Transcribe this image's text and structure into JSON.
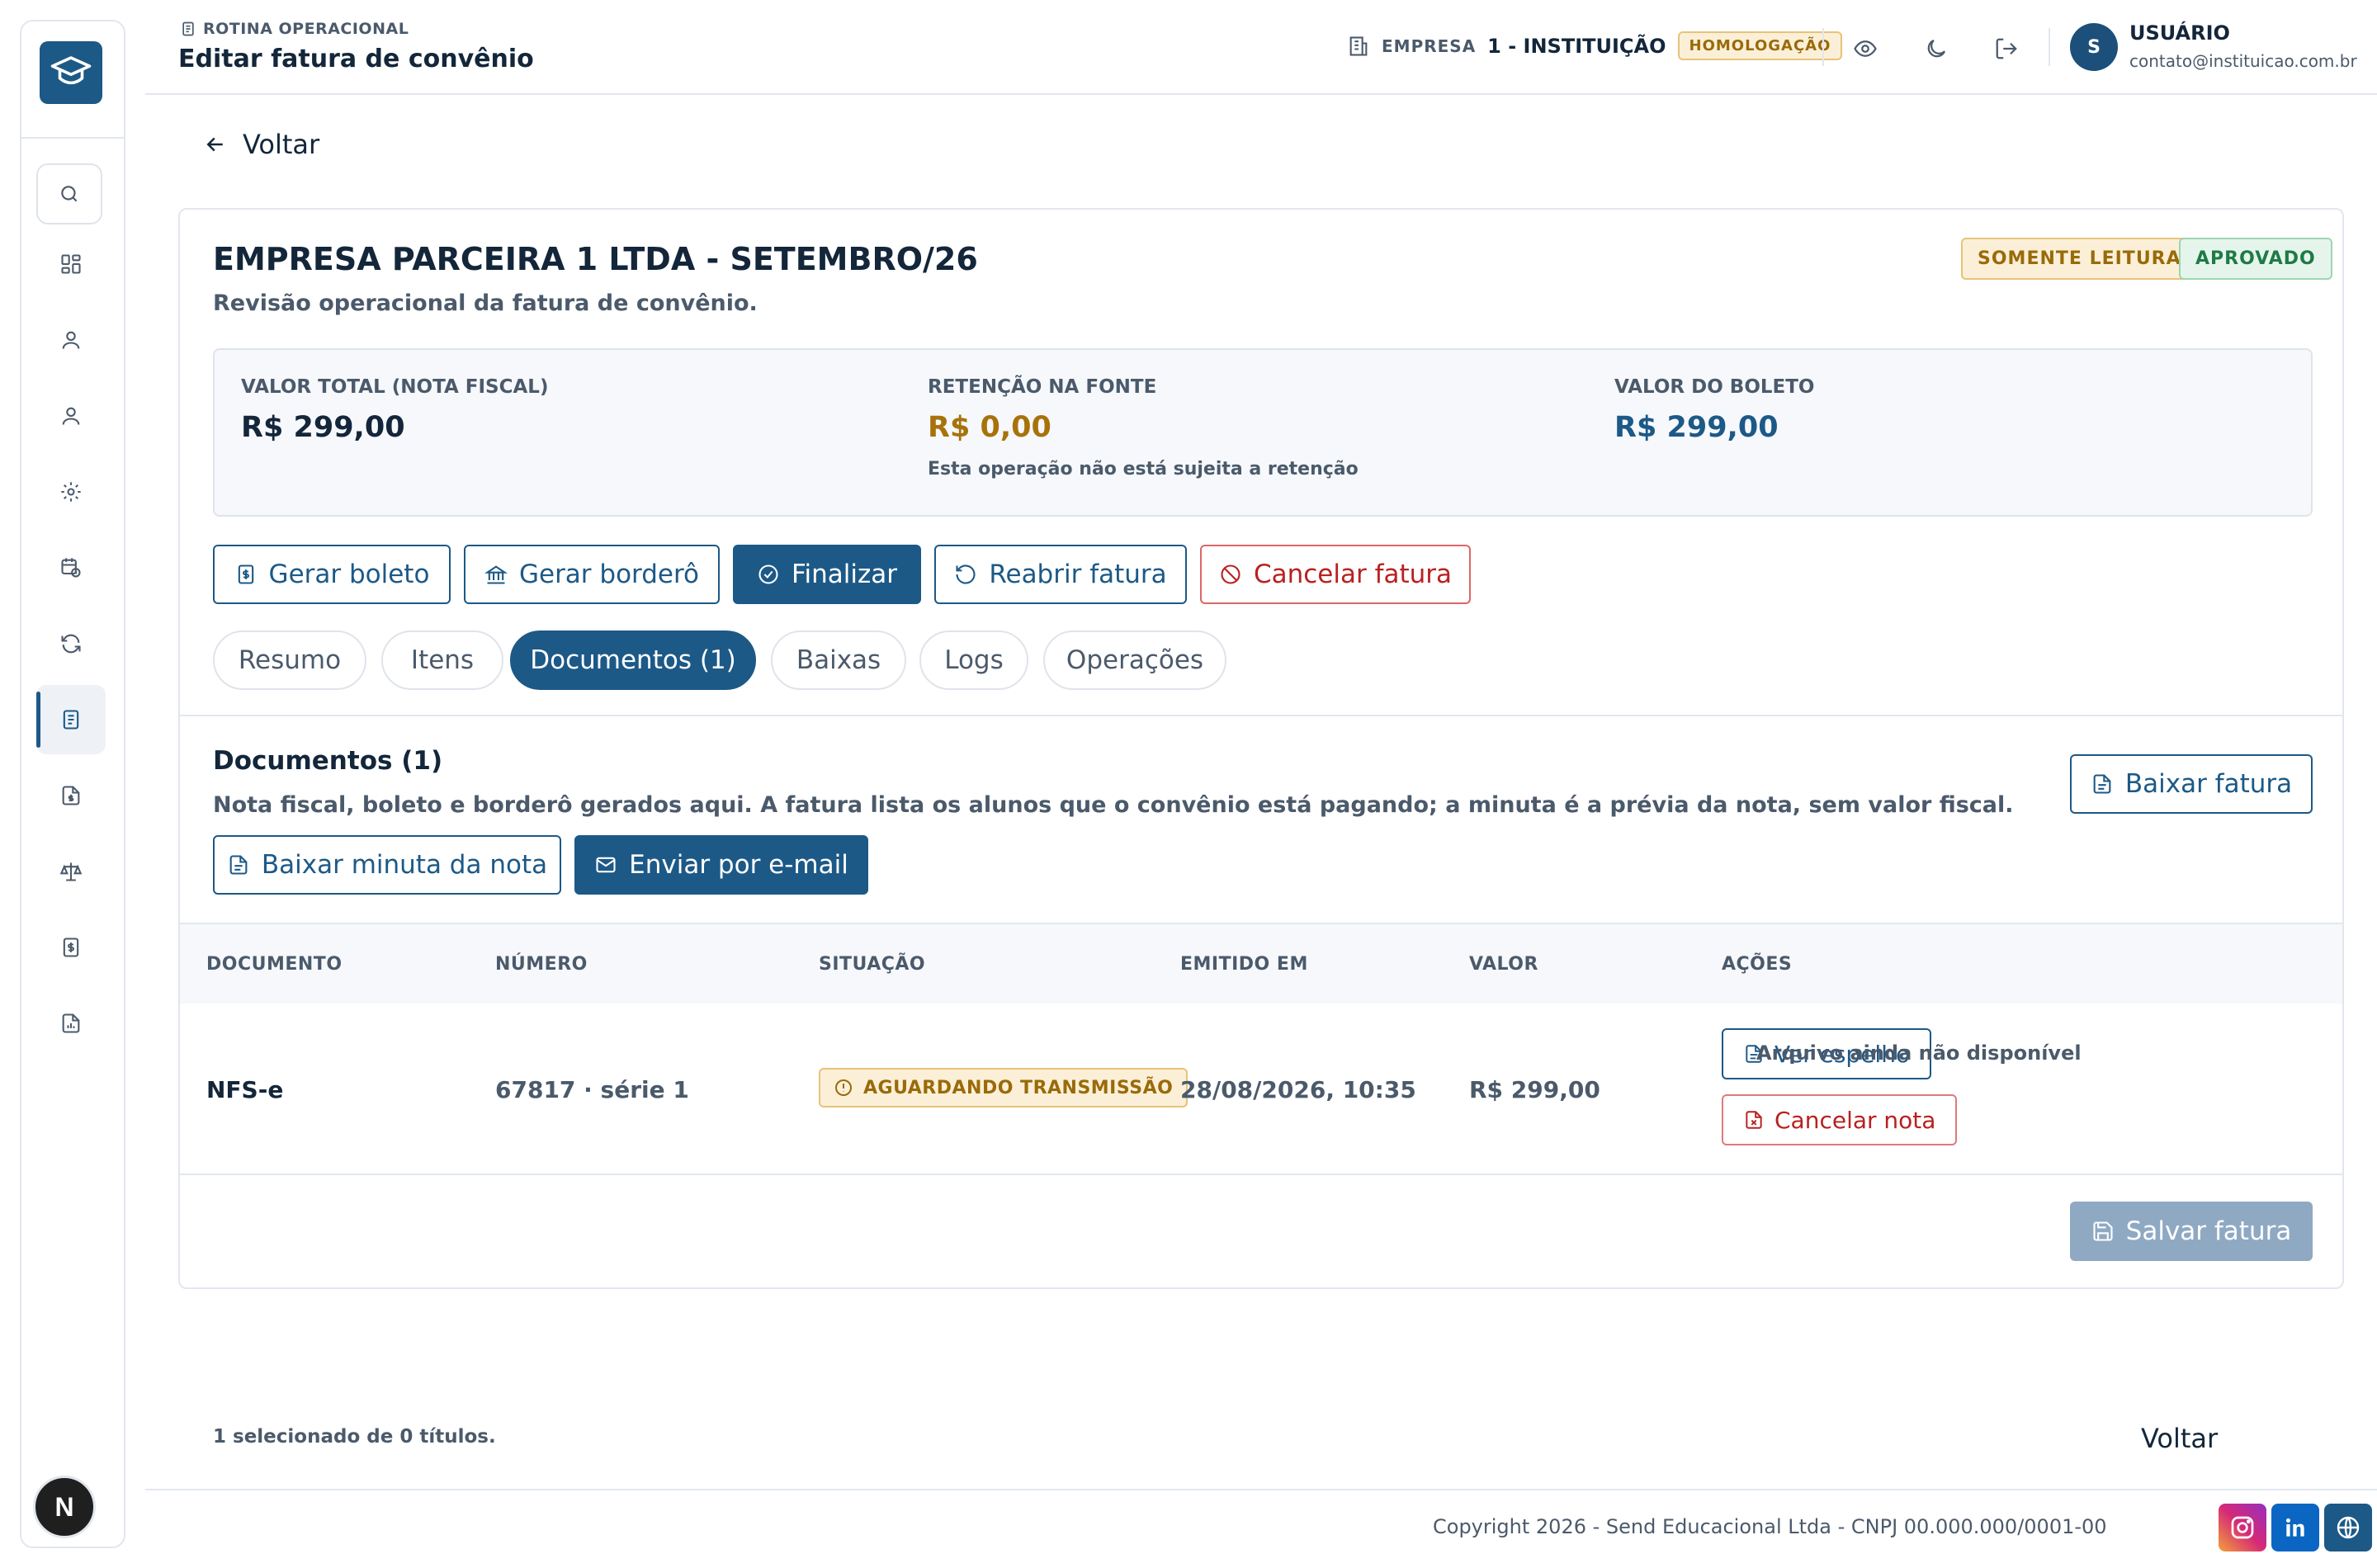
{
  "header": {
    "breadcrumb": "ROTINA OPERACIONAL",
    "title": "Editar fatura de convênio",
    "company_label": "EMPRESA",
    "company_name": "1 - INSTITUIÇÃO",
    "environment_badge": "HOMOLOGAÇÃO",
    "user_initial": "S",
    "user_name": "USUÁRIO",
    "user_email": "contato@instituicao.com.br"
  },
  "sidebar": {
    "items": [
      "dashboard-icon",
      "user-icon",
      "user-icon",
      "gear-icon",
      "calendar-clock-icon",
      "refresh-icon",
      "invoice-icon",
      "file-dollar-icon",
      "scale-icon",
      "dollar-doc-icon",
      "report-icon"
    ],
    "active_index": 6,
    "avatar_letter": "N"
  },
  "back_label": "Voltar",
  "invoice": {
    "title": "EMPRESA PARCEIRA 1 LTDA - SETEMBRO/26",
    "subtitle": "Revisão operacional da fatura de convênio.",
    "badge_readonly": "SOMENTE LEITURA",
    "badge_status": "APROVADO",
    "summary": {
      "total_label": "VALOR TOTAL (NOTA FISCAL)",
      "total_value": "R$ 299,00",
      "retention_label": "RETENÇÃO NA FONTE",
      "retention_value": "R$ 0,00",
      "retention_note": "Esta operação não está sujeita a retenção",
      "boleto_label": "VALOR DO BOLETO",
      "boleto_value": "R$ 299,00"
    },
    "actions": {
      "gerar_boleto": "Gerar boleto",
      "gerar_bordero": "Gerar borderô",
      "finalizar": "Finalizar",
      "reabrir": "Reabrir fatura",
      "cancelar": "Cancelar fatura"
    },
    "tabs": [
      "Resumo",
      "Itens",
      "Documentos (1)",
      "Baixas",
      "Logs",
      "Operações"
    ],
    "active_tab": 2
  },
  "documents": {
    "title": "Documentos (1)",
    "description": "Nota fiscal, boleto e borderô gerados aqui. A fatura lista os alunos que o convênio está pagando; a minuta é a prévia da nota, sem valor fiscal.",
    "download_invoice": "Baixar fatura",
    "download_draft": "Baixar minuta da nota",
    "send_email": "Enviar por e-mail",
    "columns": [
      "DOCUMENTO",
      "NÚMERO",
      "SITUAÇÃO",
      "EMITIDO EM",
      "VALOR",
      "AÇÕES"
    ],
    "rows": [
      {
        "documento": "NFS-e",
        "numero": "67817 · série 1",
        "situacao": "AGUARDANDO TRANSMISSÃO",
        "emitido_em": "28/08/2026, 10:35",
        "valor": "R$ 299,00",
        "ver_espelho": "Ver espelho",
        "arquivo_status": "Arquivo ainda não disponível",
        "cancelar_nota": "Cancelar nota"
      }
    ]
  },
  "footer": {
    "selection": "1 selecionado de 0 títulos.",
    "back": "Voltar",
    "save": "Salvar fatura"
  },
  "page_footer": {
    "copyright": "Copyright 2026 - Send Educacional Ltda - CNPJ 00.000.000/0001-00"
  },
  "colors": {
    "primary": "#1c5987",
    "warning": "#9a6a0a",
    "success": "#1f7a46",
    "danger": "#b8211f"
  }
}
